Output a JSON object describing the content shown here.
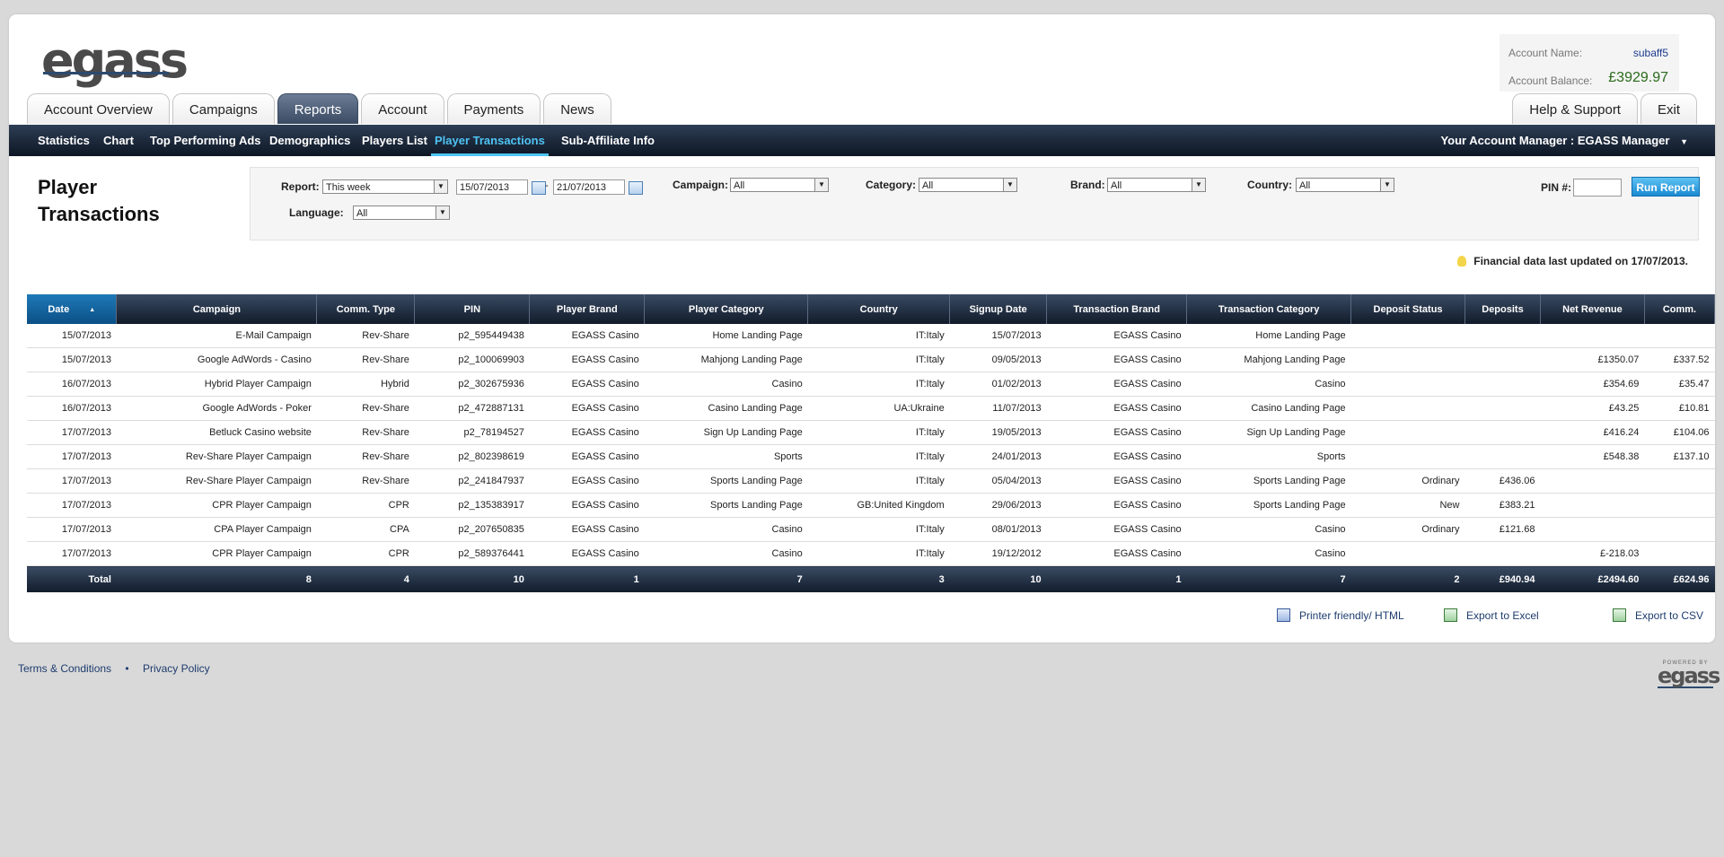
{
  "logo": "egass",
  "account": {
    "name_label": "Account Name:",
    "name_value": "subaff5",
    "balance_label": "Account Balance:",
    "balance_value": "£3929.97"
  },
  "tabs": [
    "Account Overview",
    "Campaigns",
    "Reports",
    "Account",
    "Payments",
    "News"
  ],
  "tabs_right": [
    "Help & Support",
    "Exit"
  ],
  "subnav": [
    "Statistics",
    "Chart",
    "Top Performing Ads",
    "Demographics",
    "Players List",
    "Player Transactions",
    "Sub-Affiliate Info"
  ],
  "manager": "Your Account Manager : EGASS Manager",
  "page_title_line1": "Player",
  "page_title_line2": "Transactions",
  "filters": {
    "report_label": "Report:",
    "report_value": "This week",
    "date_from": "15/07/2013",
    "date_sep": "-",
    "date_to": "21/07/2013",
    "language_label": "Language:",
    "language_value": "All",
    "campaign_label": "Campaign:",
    "campaign_value": "All",
    "category_label": "Category:",
    "category_value": "All",
    "brand_label": "Brand:",
    "brand_value": "All",
    "country_label": "Country:",
    "country_value": "All",
    "pin_label": "PIN #:",
    "pin_value": "",
    "run_label": "Run Report"
  },
  "updated_text": "Financial data last updated on 17/07/2013.",
  "table": {
    "headers": [
      "Date",
      "Campaign",
      "Comm. Type",
      "PIN",
      "Player Brand",
      "Player Category",
      "Country",
      "Signup Date",
      "Transaction Brand",
      "Transaction Category",
      "Deposit Status",
      "Deposits",
      "Net Revenue",
      "Comm."
    ],
    "rows": [
      [
        "15/07/2013",
        "E-Mail Campaign",
        "Rev-Share",
        "p2_595449438",
        "EGASS Casino",
        "Home Landing Page",
        "IT:Italy",
        "15/07/2013",
        "EGASS Casino",
        "Home Landing Page",
        "",
        "",
        "",
        ""
      ],
      [
        "15/07/2013",
        "Google AdWords - Casino",
        "Rev-Share",
        "p2_100069903",
        "EGASS Casino",
        "Mahjong Landing Page",
        "IT:Italy",
        "09/05/2013",
        "EGASS Casino",
        "Mahjong Landing Page",
        "",
        "",
        "£1350.07",
        "£337.52"
      ],
      [
        "16/07/2013",
        "Hybrid Player Campaign",
        "Hybrid",
        "p2_302675936",
        "EGASS Casino",
        "Casino",
        "IT:Italy",
        "01/02/2013",
        "EGASS Casino",
        "Casino",
        "",
        "",
        "£354.69",
        "£35.47"
      ],
      [
        "16/07/2013",
        "Google AdWords - Poker",
        "Rev-Share",
        "p2_472887131",
        "EGASS Casino",
        "Casino Landing Page",
        "UA:Ukraine",
        "11/07/2013",
        "EGASS Casino",
        "Casino Landing Page",
        "",
        "",
        "£43.25",
        "£10.81"
      ],
      [
        "17/07/2013",
        "Betluck Casino website",
        "Rev-Share",
        "p2_78194527",
        "EGASS Casino",
        "Sign Up Landing Page",
        "IT:Italy",
        "19/05/2013",
        "EGASS Casino",
        "Sign Up Landing Page",
        "",
        "",
        "£416.24",
        "£104.06"
      ],
      [
        "17/07/2013",
        "Rev-Share Player Campaign",
        "Rev-Share",
        "p2_802398619",
        "EGASS Casino",
        "Sports",
        "IT:Italy",
        "24/01/2013",
        "EGASS Casino",
        "Sports",
        "",
        "",
        "£548.38",
        "£137.10"
      ],
      [
        "17/07/2013",
        "Rev-Share Player Campaign",
        "Rev-Share",
        "p2_241847937",
        "EGASS Casino",
        "Sports Landing Page",
        "IT:Italy",
        "05/04/2013",
        "EGASS Casino",
        "Sports Landing Page",
        "Ordinary",
        "£436.06",
        "",
        ""
      ],
      [
        "17/07/2013",
        "CPR Player Campaign",
        "CPR",
        "p2_135383917",
        "EGASS Casino",
        "Sports Landing Page",
        "GB:United Kingdom",
        "29/06/2013",
        "EGASS Casino",
        "Sports Landing Page",
        "New",
        "£383.21",
        "",
        ""
      ],
      [
        "17/07/2013",
        "CPA Player Campaign",
        "CPA",
        "p2_207650835",
        "EGASS Casino",
        "Casino",
        "IT:Italy",
        "08/01/2013",
        "EGASS Casino",
        "Casino",
        "Ordinary",
        "£121.68",
        "",
        ""
      ],
      [
        "17/07/2013",
        "CPR Player Campaign",
        "CPR",
        "p2_589376441",
        "EGASS Casino",
        "Casino",
        "IT:Italy",
        "19/12/2012",
        "EGASS Casino",
        "Casino",
        "",
        "",
        "£-218.03",
        ""
      ]
    ],
    "total": [
      "Total",
      "8",
      "4",
      "10",
      "1",
      "7",
      "3",
      "10",
      "1",
      "7",
      "2",
      "£940.94",
      "£2494.60",
      "£624.96"
    ]
  },
  "exports": [
    "Printer friendly/ HTML",
    "Export to Excel",
    "Export to CSV"
  ],
  "footer": {
    "terms": "Terms & Conditions",
    "sep": "•",
    "privacy": "Privacy Policy",
    "powered_by": "POWERED BY",
    "powered_logo": "egass"
  },
  "colors": {
    "nav_dark": "#0d1624",
    "accent": "#4ec3f3",
    "balance_green": "#2a6a1a",
    "link_blue": "#1e3c6e"
  },
  "icons": [
    "calendar-icon",
    "sort-arrow-icon",
    "lightbulb-icon",
    "html-icon",
    "excel-icon",
    "csv-icon",
    "chevron-down-icon"
  ]
}
